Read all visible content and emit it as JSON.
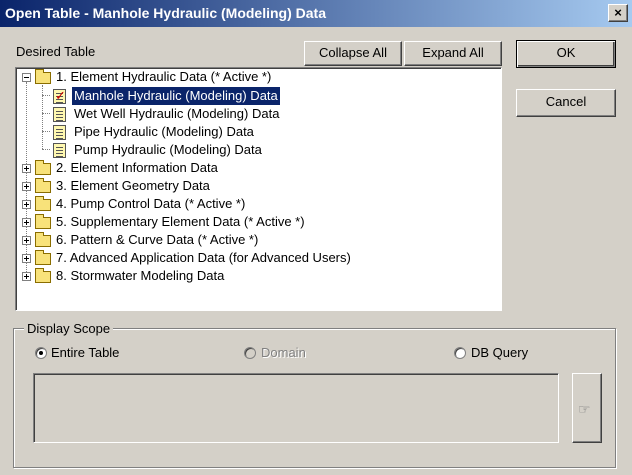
{
  "window": {
    "title": "Open Table - Manhole Hydraulic (Modeling) Data",
    "close_label": "×"
  },
  "toolbar": {
    "desired_table_label": "Desired Table",
    "collapse_all_label": "Collapse All",
    "expand_all_label": "Expand All"
  },
  "dialog_buttons": {
    "ok_label": "OK",
    "cancel_label": "Cancel"
  },
  "tree": {
    "root": {
      "label": "1. Element Hydraulic Data (* Active *)",
      "expanded": true,
      "children": [
        {
          "label": "Manhole Hydraulic (Modeling) Data",
          "selected": true,
          "checked": true
        },
        {
          "label": "Wet Well Hydraulic (Modeling) Data"
        },
        {
          "label": "Pipe Hydraulic (Modeling) Data"
        },
        {
          "label": "Pump Hydraulic (Modeling) Data"
        }
      ]
    },
    "groups": [
      {
        "label": "2. Element Information Data"
      },
      {
        "label": "3. Element Geometry Data"
      },
      {
        "label": "4. Pump Control Data (* Active *)"
      },
      {
        "label": "5. Supplementary Element Data (* Active *)"
      },
      {
        "label": "6. Pattern & Curve Data (* Active *)"
      },
      {
        "label": "7. Advanced Application Data (for Advanced Users)"
      },
      {
        "label": "8. Stormwater Modeling Data"
      }
    ]
  },
  "display_scope": {
    "label": "Display Scope",
    "options": [
      {
        "label": "Entire Table",
        "selected": true,
        "enabled": true
      },
      {
        "label": "Domain",
        "selected": false,
        "enabled": false
      },
      {
        "label": "DB Query",
        "selected": false,
        "enabled": true
      }
    ],
    "query_text": ""
  }
}
